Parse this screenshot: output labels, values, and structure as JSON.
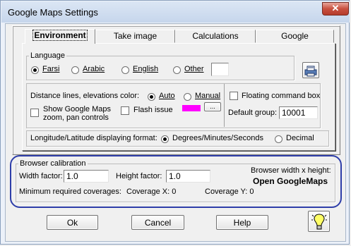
{
  "window": {
    "title": "Google Maps Settings",
    "close_glyph": "✕"
  },
  "tabs": [
    {
      "label": "Environment",
      "active": true
    },
    {
      "label": "Take image",
      "active": false
    },
    {
      "label": "Calculations",
      "active": false
    },
    {
      "label": "Google",
      "active": false
    }
  ],
  "language": {
    "legend": "Language",
    "options": [
      "Farsi",
      "Arabic",
      "English",
      "Other"
    ],
    "selected": "Farsi",
    "other_value": ""
  },
  "distance": {
    "color_label": "Distance lines, elevations color:",
    "auto_label": "Auto",
    "manual_label": "Manual",
    "selected": "Auto",
    "show_google_maps_line1": "Show Google Maps",
    "show_google_maps_line2": "zoom, pan controls",
    "flash_issue_label": "Flash issue",
    "swatch_color": "#ff00ff",
    "more_button": "..."
  },
  "floating": {
    "command_box_label": "Floating command box",
    "default_group_label": "Default group:",
    "default_group_value": "10001"
  },
  "coords": {
    "label": "Longitude/Latitude displaying format:",
    "dms_label": "Degrees/Minutes/Seconds",
    "decimal_label": "Decimal",
    "selected": "Degrees/Minutes/Seconds"
  },
  "browser": {
    "legend": "Browser calibration",
    "width_factor_label": "Width factor:",
    "width_factor_value": "1.0",
    "height_factor_label": "Height factor:",
    "height_factor_value": "1.0",
    "bw_label": "Browser width x height:",
    "open_label": "Open GoogleMaps",
    "min_cov_label": "Minimum required coverages:",
    "coverage_x": "Coverage X: 0",
    "coverage_y": "Coverage Y: 0"
  },
  "buttons": {
    "ok": "Ok",
    "cancel": "Cancel",
    "help": "Help"
  },
  "colors": {
    "highlight_border": "#2e3ea9",
    "swatch": "#ff00ff"
  }
}
